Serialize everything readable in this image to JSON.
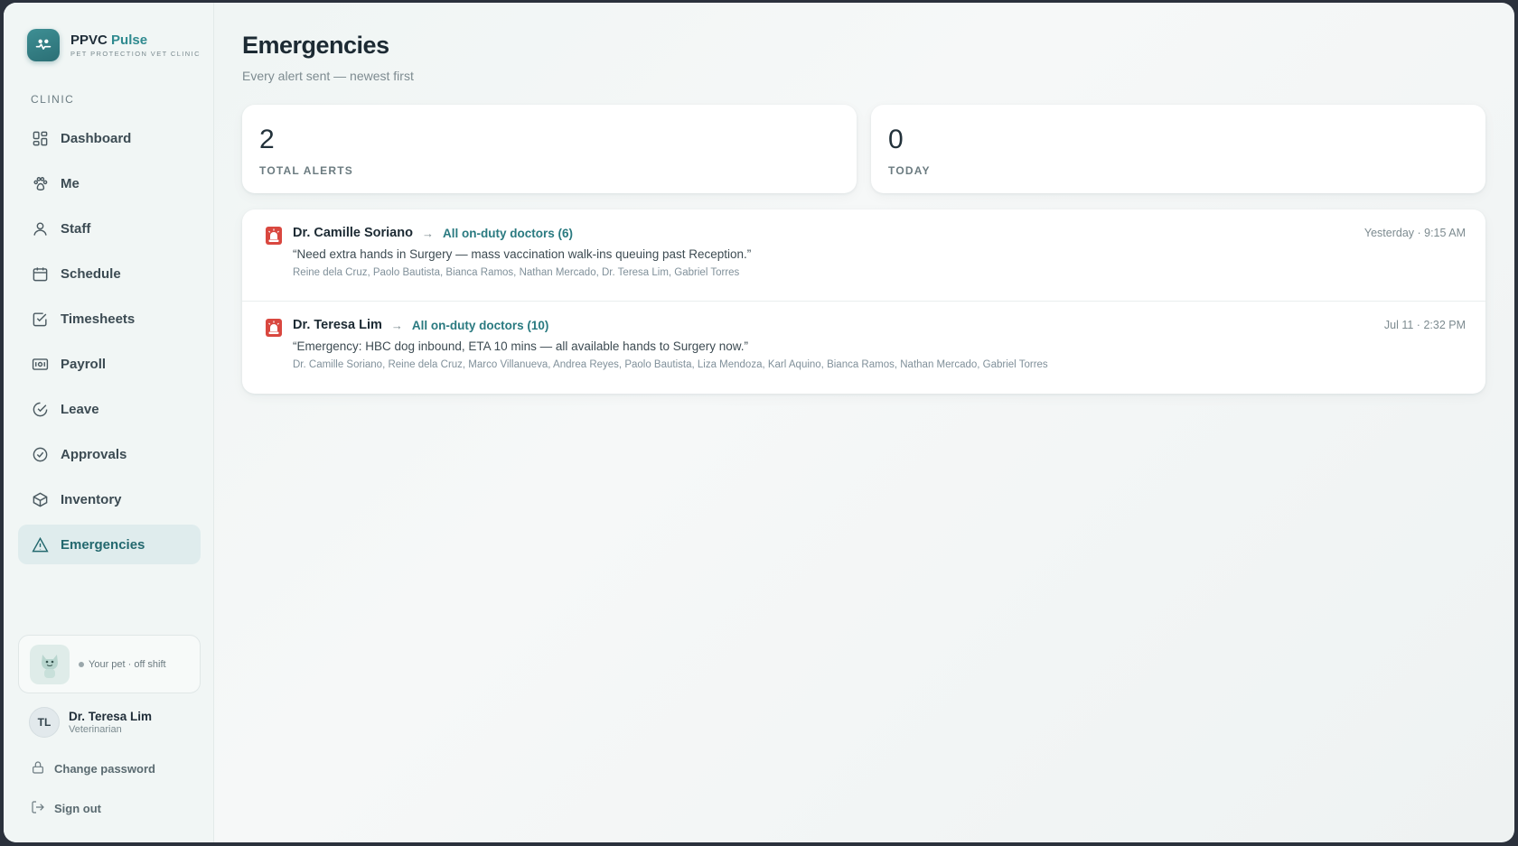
{
  "brand": {
    "name": "PPVC",
    "accent": "Pulse",
    "subtitle": "PET PROTECTION VET CLINIC"
  },
  "sidebar": {
    "section_label": "CLINIC",
    "items": [
      {
        "label": "Dashboard",
        "icon": "grid-icon"
      },
      {
        "label": "Me",
        "icon": "paw-icon"
      },
      {
        "label": "Staff",
        "icon": "user-icon"
      },
      {
        "label": "Schedule",
        "icon": "calendar-icon"
      },
      {
        "label": "Timesheets",
        "icon": "checkbox-icon"
      },
      {
        "label": "Payroll",
        "icon": "banknote-icon"
      },
      {
        "label": "Leave",
        "icon": "leave-icon"
      },
      {
        "label": "Approvals",
        "icon": "check-circle-icon"
      },
      {
        "label": "Inventory",
        "icon": "box-icon"
      },
      {
        "label": "Emergencies",
        "icon": "warning-icon",
        "active": true
      }
    ],
    "pet": {
      "status": "Your pet · off shift"
    },
    "user": {
      "initials": "TL",
      "name": "Dr. Teresa Lim",
      "role": "Veterinarian"
    },
    "change_password": "Change password",
    "sign_out": "Sign out"
  },
  "main": {
    "title": "Emergencies",
    "subtitle": "Every alert sent — newest first",
    "stats": [
      {
        "value": "2",
        "label": "TOTAL ALERTS"
      },
      {
        "value": "0",
        "label": "TODAY"
      }
    ],
    "alerts": [
      {
        "sender": "Dr. Camille Soriano",
        "target": "All on-duty doctors (6)",
        "time": "Yesterday · 9:15 AM",
        "message": "“Need extra hands in Surgery — mass vaccination walk-ins queuing past Reception.”",
        "recipients": "Reine dela Cruz, Paolo Bautista, Bianca Ramos, Nathan Mercado, Dr. Teresa Lim, Gabriel Torres"
      },
      {
        "sender": "Dr. Teresa Lim",
        "target": "All on-duty doctors (10)",
        "time": "Jul 11 · 2:32 PM",
        "message": "“Emergency: HBC dog inbound, ETA 10 mins — all available hands to Surgery now.”",
        "recipients": "Dr. Camille Soriano, Reine dela Cruz, Marco Villanueva, Andrea Reyes, Paolo Bautista, Liza Mendoza, Karl Aquino, Bianca Ramos, Nathan Mercado, Gabriel Torres"
      }
    ]
  },
  "colors": {
    "accent": "#2f8a8f",
    "active_bg": "#dfeced",
    "alert_red": "#d9473f"
  }
}
